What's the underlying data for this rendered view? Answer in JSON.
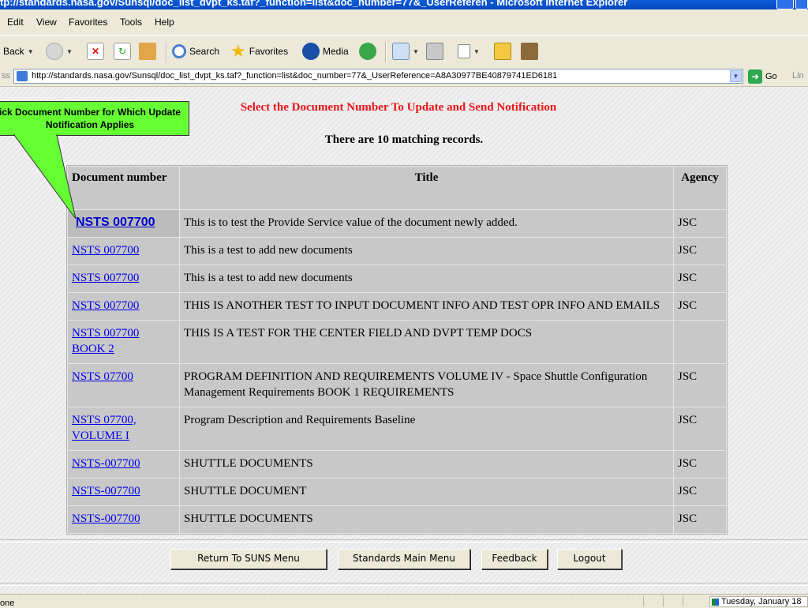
{
  "window": {
    "title": "tp://standards.nasa.gov/Sunsql/doc_list_dvpt_ks.taf?_function=list&doc_number=77&_UserReferen - Microsoft Internet Explorer"
  },
  "menu": {
    "items": [
      "Edit",
      "View",
      "Favorites",
      "Tools",
      "Help"
    ]
  },
  "toolbar": {
    "back_label": "Back",
    "search_label": "Search",
    "favorites_label": "Favorites",
    "media_label": "Media"
  },
  "address": {
    "label": "ss",
    "url": "http://standards.nasa.gov/Sunsql/doc_list_dvpt_ks.taf?_function=list&doc_number=77&_UserReference=A8A30977BE40879741ED6181",
    "go_label": "Go",
    "links_label": "Lin"
  },
  "page": {
    "heading": "Select the Document Number To Update and Send Notification",
    "records_text": "There are 10 matching records.",
    "callout": "ick Document Number for Which Update Notification Applies",
    "columns": [
      "Document number",
      "Title",
      "Agency"
    ],
    "rows": [
      {
        "doc": "NSTS 007700",
        "title": "This is to test the Provide Service value of the document newly added.",
        "agency": "JSC"
      },
      {
        "doc": "NSTS 007700",
        "title": "This is a test to add new documents",
        "agency": "JSC"
      },
      {
        "doc": "NSTS 007700",
        "title": "This is a test to add new documents",
        "agency": "JSC"
      },
      {
        "doc": "NSTS 007700",
        "title": "THIS IS ANOTHER TEST TO INPUT DOCUMENT INFO AND TEST OPR INFO AND EMAILS",
        "agency": "JSC"
      },
      {
        "doc": "NSTS 007700 BOOK 2",
        "title": "THIS IS A TEST FOR THE CENTER FIELD AND DVPT TEMP DOCS",
        "agency": ""
      },
      {
        "doc": "NSTS 07700",
        "title": "PROGRAM DEFINITION AND REQUIREMENTS VOLUME IV - Space Shuttle Configuration Management Requirements BOOK 1 REQUIREMENTS",
        "agency": "JSC"
      },
      {
        "doc": "NSTS 07700, VOLUME I",
        "title": "Program Description and Requirements Baseline",
        "agency": "JSC"
      },
      {
        "doc": "NSTS-007700",
        "title": "SHUTTLE DOCUMENTS",
        "agency": "JSC"
      },
      {
        "doc": "NSTS-007700",
        "title": "SHUTTLE DOCUMENT",
        "agency": "JSC"
      },
      {
        "doc": "NSTS-007700",
        "title": "SHUTTLE DOCUMENTS",
        "agency": "JSC"
      }
    ],
    "buttons": [
      "Return To SUNS Menu",
      "Standards Main Menu",
      "Feedback",
      "Logout"
    ]
  },
  "status": {
    "text": "one",
    "date": "Tuesday, January 18"
  },
  "colors": {
    "heading": "#e8141a",
    "callout": "#66ff33",
    "link": "#0000ee",
    "titlebar": "#0a5bd8"
  }
}
